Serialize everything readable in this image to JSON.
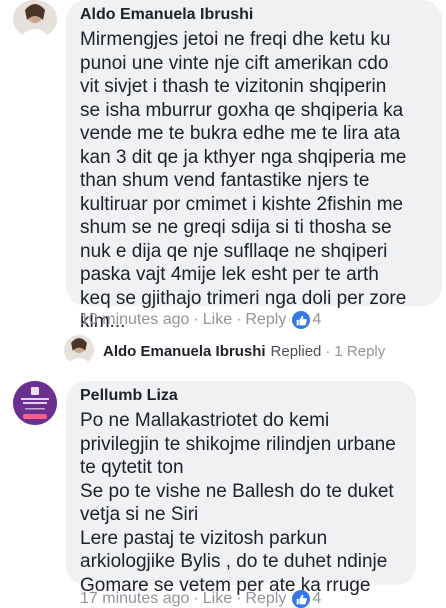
{
  "comments": [
    {
      "author": "Aldo Emanuela Ibrushi",
      "text": "Mirmengjes jetoi ne freqi dhe ketu ku\npunoi une vinte nje cift amerikan cdo\nvit sivjet i thash te vizitonin shqiperin\nse isha mburrur goxha qe shqiperia ka\nvende me te bukra  edhe me te lira ata\nkan 3 dit qe ja kthyer nga shqiperia me\nthan shum vend fantastike njers te\nkultiruar por cmimet i kishte 2fishin me\nshum se ne greqi sdija si ti  thosha se\nnuk e dija qe nje sufllaqe ne shqiperi\npaska vajt 4mije lek esht per te arth\nkeq se gjithajo trimeri nga doli per zore\nklm...",
      "time": "10 minutes ago",
      "like": "Like",
      "reply": "Reply",
      "reactions": "4",
      "reaction_icon": "thumbs-up-icon"
    },
    {
      "author": "Pellumb Liza",
      "text": "Po ne Mallakastriotet do kemi\nprivilegjin te shikojme rilindjen urbane\nte qytetit ton\nSe po te vishe ne Ballesh do te duket\nvetja si ne Siri\nLere pastaj te vizitosh parkun\narkiologjike Bylis ,  do te duhet ndinje\nGomare se vetem per ate ka rruge",
      "time": "17 minutes ago",
      "like": "Like",
      "reply": "Reply",
      "reactions": "4"
    }
  ],
  "reply_summary": {
    "author": "Aldo Emanuela Ibrushi",
    "status": "Replied",
    "count": "1 Reply"
  },
  "separator": "·",
  "colors": {
    "bubble": "#f0f1f3",
    "meta": "#90949c",
    "like_badge": "#3578e5",
    "avatar2_bg": "#6a2f8f"
  }
}
